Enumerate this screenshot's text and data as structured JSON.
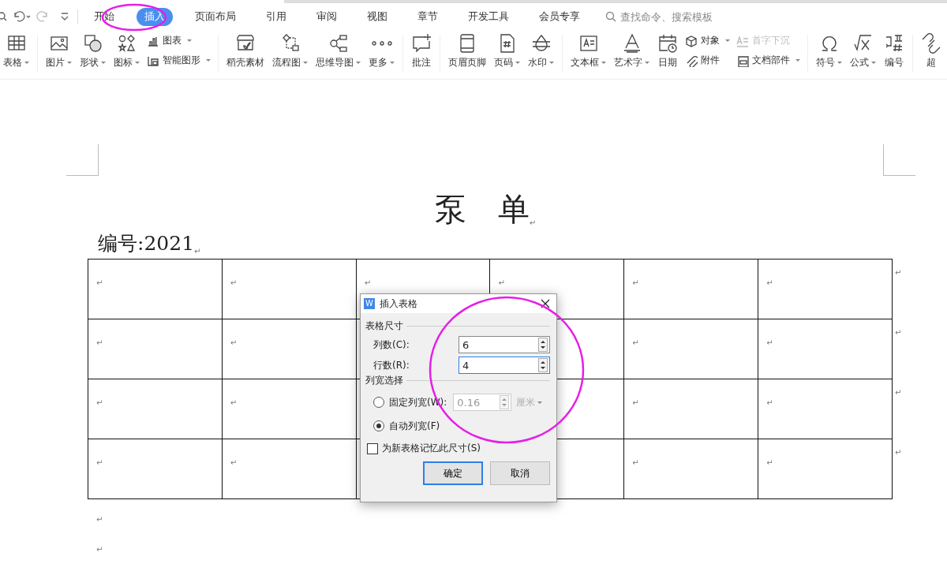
{
  "tabs": [
    {
      "label": "开始",
      "selected": false
    },
    {
      "label": "插入",
      "selected": true
    },
    {
      "label": "页面布局",
      "selected": false
    },
    {
      "label": "引用",
      "selected": false
    },
    {
      "label": "审阅",
      "selected": false
    },
    {
      "label": "视图",
      "selected": false
    },
    {
      "label": "章节",
      "selected": false
    },
    {
      "label": "开发工具",
      "selected": false
    },
    {
      "label": "会员专享",
      "selected": false
    }
  ],
  "search": {
    "placeholder": "查找命令、搜索模板"
  },
  "ribbon": [
    [
      {
        "kind": "large",
        "label": "表格",
        "dropdown": true
      }
    ],
    [
      {
        "kind": "large",
        "label": "图片",
        "dropdown": true
      },
      {
        "kind": "large",
        "label": "形状",
        "dropdown": true
      },
      {
        "kind": "large",
        "label": "图标",
        "dropdown": true
      },
      {
        "kind": "stack",
        "items": [
          {
            "label": "图表",
            "dropdown": true,
            "disabled": false
          },
          {
            "label": "智能图形",
            "dropdown": true,
            "disabled": false
          }
        ]
      }
    ],
    [
      {
        "kind": "large",
        "label": "稻壳素材",
        "dropdown": false
      },
      {
        "kind": "large",
        "label": "流程图",
        "dropdown": true
      },
      {
        "kind": "large",
        "label": "思维导图",
        "dropdown": true
      },
      {
        "kind": "large",
        "label": "更多",
        "dropdown": true
      }
    ],
    [
      {
        "kind": "large",
        "label": "批注",
        "dropdown": false
      }
    ],
    [
      {
        "kind": "large",
        "label": "页眉页脚",
        "dropdown": false
      },
      {
        "kind": "large",
        "label": "页码",
        "dropdown": true
      },
      {
        "kind": "large",
        "label": "水印",
        "dropdown": true
      }
    ],
    [
      {
        "kind": "large",
        "label": "文本框",
        "dropdown": true
      },
      {
        "kind": "large",
        "label": "艺术字",
        "dropdown": true
      },
      {
        "kind": "large",
        "label": "日期",
        "dropdown": false
      },
      {
        "kind": "stack",
        "items": [
          {
            "label": "对象",
            "dropdown": true,
            "disabled": false
          },
          {
            "label": "附件",
            "dropdown": false,
            "disabled": false
          }
        ]
      },
      {
        "kind": "stack",
        "items": [
          {
            "label": "首字下沉",
            "dropdown": false,
            "disabled": true
          },
          {
            "label": "文档部件",
            "dropdown": true,
            "disabled": false
          }
        ]
      }
    ],
    [
      {
        "kind": "large",
        "label": "符号",
        "dropdown": true
      },
      {
        "kind": "large",
        "label": "公式",
        "dropdown": true
      },
      {
        "kind": "large",
        "label": "编号",
        "dropdown": false
      }
    ],
    [
      {
        "kind": "large",
        "label": "超",
        "dropdown": false
      }
    ]
  ],
  "document": {
    "title": "泵　单",
    "title_mark": "↵",
    "number_line": "编号:2021",
    "number_mark": "↵",
    "table": {
      "rows": [
        [
          "↵",
          "↵",
          "↵",
          "↵",
          "↵",
          "↵"
        ],
        [
          "↵",
          "↵",
          null,
          null,
          "↵",
          "↵"
        ],
        [
          "↵",
          "↵",
          null,
          null,
          "↵",
          "↵"
        ],
        [
          "↵",
          "↵",
          null,
          null,
          "↵",
          "↵"
        ]
      ],
      "row_marks": [
        "↵",
        "↵",
        "↵",
        "↵"
      ]
    },
    "after_marks": [
      "↵",
      "↵"
    ]
  },
  "dialog": {
    "icon_letter": "W",
    "title": "插入表格",
    "size_heading": "表格尺寸",
    "fields": [
      {
        "label": "列数(C):",
        "value": "6",
        "focused": false
      },
      {
        "label": "行数(R):",
        "value": "4",
        "focused": true
      }
    ],
    "width_heading": "列宽选择",
    "options": [
      {
        "label": "固定列宽(W):",
        "selected": false,
        "value": "0.16",
        "unit": "厘米"
      },
      {
        "label": "自动列宽(F)",
        "selected": true
      }
    ],
    "remember": {
      "label": "为新表格记忆此尺寸(S)",
      "checked": false
    },
    "buttons": [
      {
        "label": "确定",
        "default": true
      },
      {
        "label": "取消",
        "default": false
      }
    ]
  }
}
